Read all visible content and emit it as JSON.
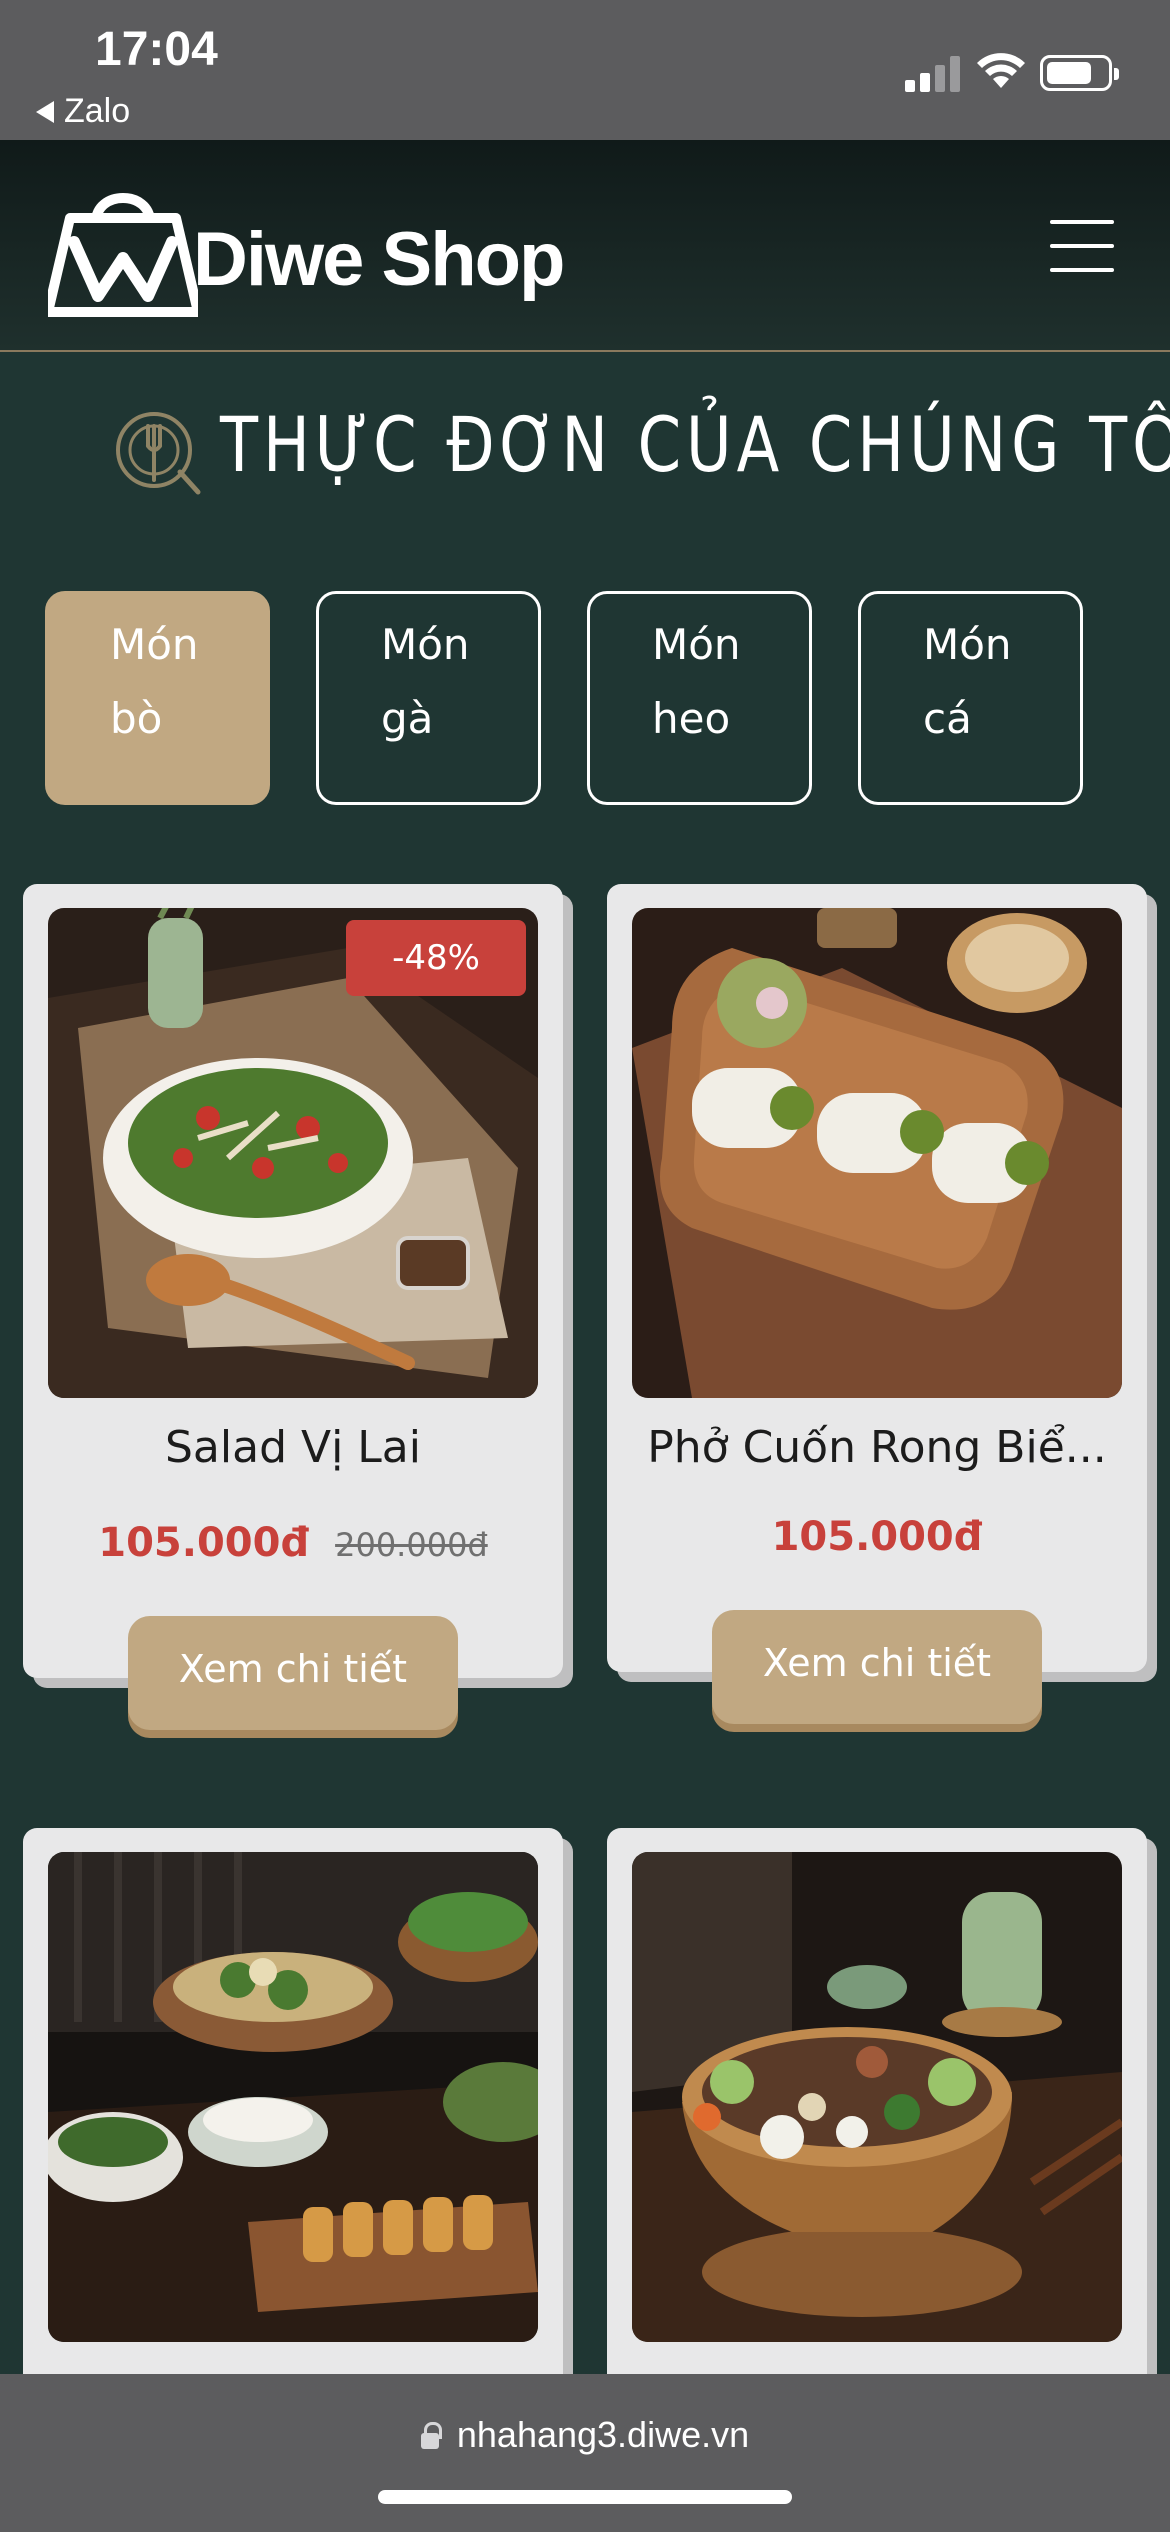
{
  "status_bar": {
    "time": "17:04",
    "back_app": "Zalo"
  },
  "header": {
    "brand": "Diwe Shop",
    "logo_icon": "shopping-bag-logo-icon",
    "menu_icon": "hamburger-menu-icon"
  },
  "section": {
    "title": "THỰC ĐƠN CỦA CHÚNG TÔI",
    "icon": "plate-fork-icon"
  },
  "tabs": [
    {
      "line1": "Món",
      "line2": "bò",
      "active": true
    },
    {
      "line1": "Món",
      "line2": "gà",
      "active": false
    },
    {
      "line1": "Món",
      "line2": "heo",
      "active": false
    },
    {
      "line1": "Món",
      "line2": "cá",
      "active": false
    }
  ],
  "products": [
    {
      "name": "Salad Vị Lai",
      "price": "105.000đ",
      "old_price": "200.000đ",
      "discount": "-48%",
      "button": "Xem chi tiết"
    },
    {
      "name": "Phở Cuốn Rong Biể...",
      "price": "105.000đ",
      "button": "Xem chi tiết"
    },
    {
      "name": "",
      "price": ""
    },
    {
      "name": "",
      "price": ""
    }
  ],
  "browser": {
    "url": "nhahang3.diwe.vn"
  },
  "colors": {
    "background": "#1f3633",
    "accent_tan": "#c1a882",
    "price_red": "#c8413b",
    "card_bg": "#e8e8e9"
  }
}
